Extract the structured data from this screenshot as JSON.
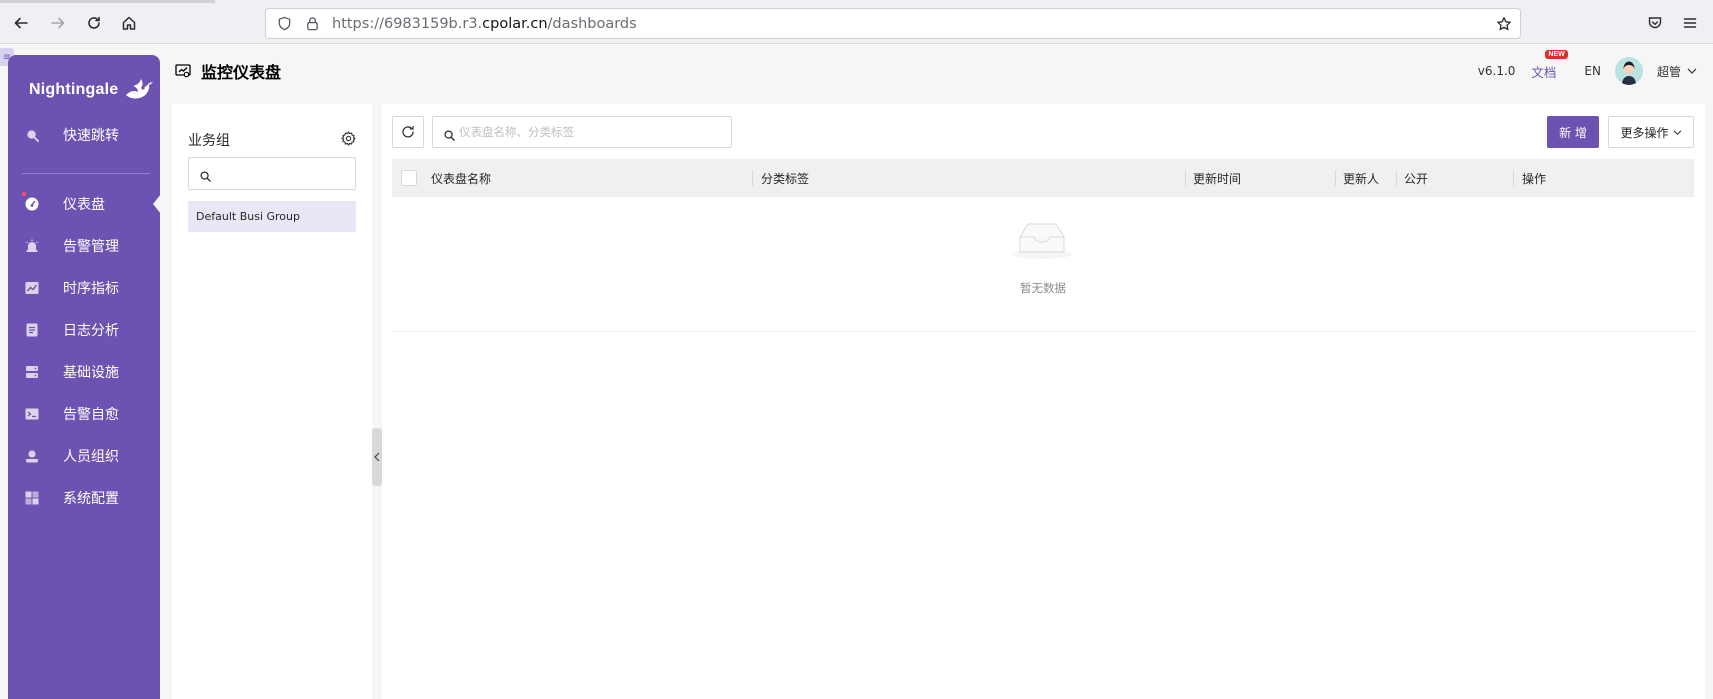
{
  "browser": {
    "url_prefix": "https://6983159b.r3.",
    "url_domain": "cpolar.cn",
    "url_path": "/dashboards"
  },
  "sidebar": {
    "logo_text": "Nightingale",
    "items": [
      {
        "label": "快速跳转",
        "icon": "search-icon"
      },
      {
        "label": "仪表盘",
        "icon": "dashboard-icon",
        "active": true
      },
      {
        "label": "告警管理",
        "icon": "alarm-icon"
      },
      {
        "label": "时序指标",
        "icon": "line-chart-icon"
      },
      {
        "label": "日志分析",
        "icon": "log-icon"
      },
      {
        "label": "基础设施",
        "icon": "server-icon"
      },
      {
        "label": "告警自愈",
        "icon": "terminal-icon"
      },
      {
        "label": "人员组织",
        "icon": "user-icon"
      },
      {
        "label": "系统配置",
        "icon": "settings-grid-icon"
      }
    ],
    "accent_color": "#6c53b1"
  },
  "header": {
    "title": "监控仪表盘",
    "version": "v6.1.0",
    "docs_label": "文档",
    "docs_badge": "NEW",
    "lang": "EN",
    "username": "超管"
  },
  "business_group": {
    "title": "业务组",
    "search_placeholder": "",
    "items": [
      "Default Busi Group"
    ]
  },
  "dashboard_list": {
    "search_placeholder": "仪表盘名称、分类标签",
    "add_label": "新 增",
    "more_label": "更多操作",
    "columns": [
      "仪表盘名称",
      "分类标签",
      "更新时间",
      "更新人",
      "公开",
      "操作"
    ],
    "rows": [],
    "empty_text": "暂无数据"
  }
}
